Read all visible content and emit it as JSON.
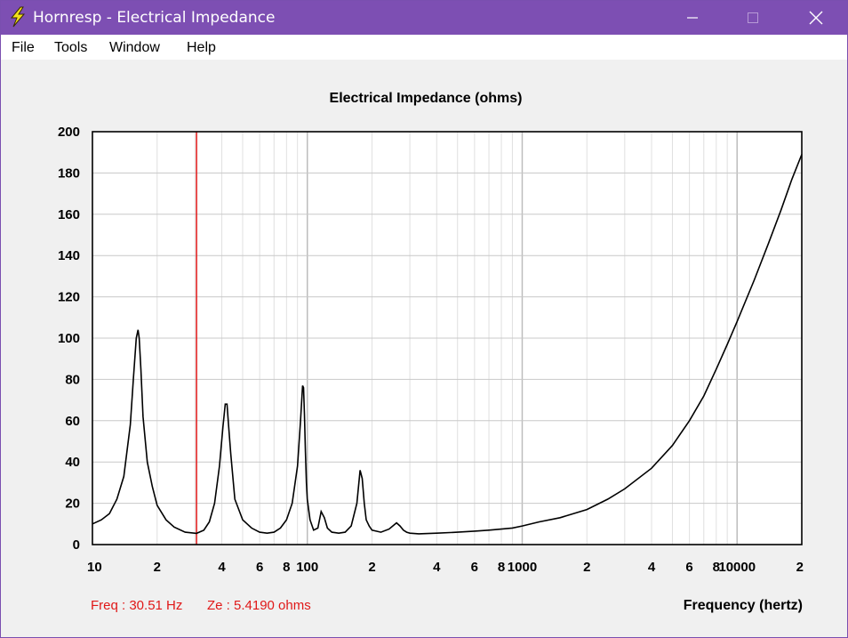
{
  "window": {
    "title": "Hornresp - Electrical Impedance",
    "icon": "lightning-bolt-icon",
    "accent_color": "#7d4fb3"
  },
  "menu": {
    "file": "File",
    "tools": "Tools",
    "window": "Window",
    "help": "Help"
  },
  "readout": {
    "freq": "Freq : 30.51 Hz",
    "ze": "Ze : 5.4190 ohms",
    "color": "#e01818"
  },
  "chart_data": {
    "type": "line",
    "title": "Electrical Impedance (ohms)",
    "xlabel": "Frequency (hertz)",
    "ylabel": "",
    "x_scale": "log",
    "xlim": [
      10,
      20000
    ],
    "ylim": [
      0,
      200
    ],
    "grid": true,
    "y_ticks": [
      "0",
      "20",
      "40",
      "60",
      "80",
      "100",
      "120",
      "140",
      "160",
      "180",
      "200"
    ],
    "x_ticks": [
      {
        "value": 10,
        "label": "10"
      },
      {
        "value": 20,
        "label": "2"
      },
      {
        "value": 40,
        "label": "4"
      },
      {
        "value": 60,
        "label": "6"
      },
      {
        "value": 80,
        "label": "8"
      },
      {
        "value": 100,
        "label": "100"
      },
      {
        "value": 200,
        "label": "2"
      },
      {
        "value": 400,
        "label": "4"
      },
      {
        "value": 600,
        "label": "6"
      },
      {
        "value": 800,
        "label": "8"
      },
      {
        "value": 1000,
        "label": "1000"
      },
      {
        "value": 2000,
        "label": "2"
      },
      {
        "value": 4000,
        "label": "4"
      },
      {
        "value": 6000,
        "label": "6"
      },
      {
        "value": 8000,
        "label": "8"
      },
      {
        "value": 10000,
        "label": "10000"
      },
      {
        "value": 20000,
        "label": "2"
      }
    ],
    "cursor_freq": 30.51,
    "series": [
      {
        "color": "#000000",
        "x": [
          10,
          11,
          12,
          13,
          14,
          15,
          15.5,
          16,
          16.3,
          16.5,
          16.8,
          17.2,
          18,
          19,
          20,
          22,
          24,
          27,
          30.5,
          33,
          35,
          37,
          39,
          40.5,
          41.5,
          42.3,
          43,
          44,
          46,
          50,
          55,
          60,
          65,
          70,
          75,
          80,
          85,
          90,
          93,
          95,
          96,
          97,
          98,
          99,
          100,
          103,
          107,
          112,
          116,
          120,
          124,
          130,
          140,
          150,
          160,
          170,
          176,
          180,
          184,
          188,
          194,
          200,
          220,
          240,
          260,
          270,
          280,
          290,
          300,
          330,
          400,
          500,
          600,
          700,
          800,
          900,
          1000,
          1200,
          1500,
          2000,
          2500,
          3000,
          4000,
          5000,
          6000,
          7000,
          8000,
          9000,
          10000,
          12000,
          14000,
          16000,
          18000,
          20000
        ],
        "y": [
          10,
          12,
          15,
          22,
          33,
          58,
          80,
          100,
          104,
          100,
          85,
          62,
          40,
          28,
          19,
          12,
          8.5,
          6,
          5.42,
          7,
          11,
          20,
          38,
          57,
          68,
          68,
          58,
          44,
          22,
          12,
          8,
          6,
          5.5,
          6,
          8,
          12,
          20,
          38,
          60,
          77,
          76,
          63,
          45,
          30,
          22,
          12,
          7,
          8,
          16,
          13,
          8,
          6,
          5.5,
          6,
          9,
          20,
          36,
          32,
          20,
          12,
          9,
          7,
          6,
          7.5,
          10.5,
          9,
          7,
          6,
          5.5,
          5.2,
          5.5,
          6,
          6.5,
          7,
          7.5,
          8,
          9,
          11,
          13,
          17,
          22,
          27,
          37,
          48,
          60,
          72,
          85,
          97,
          108,
          128,
          146,
          162,
          177,
          189
        ]
      }
    ]
  }
}
